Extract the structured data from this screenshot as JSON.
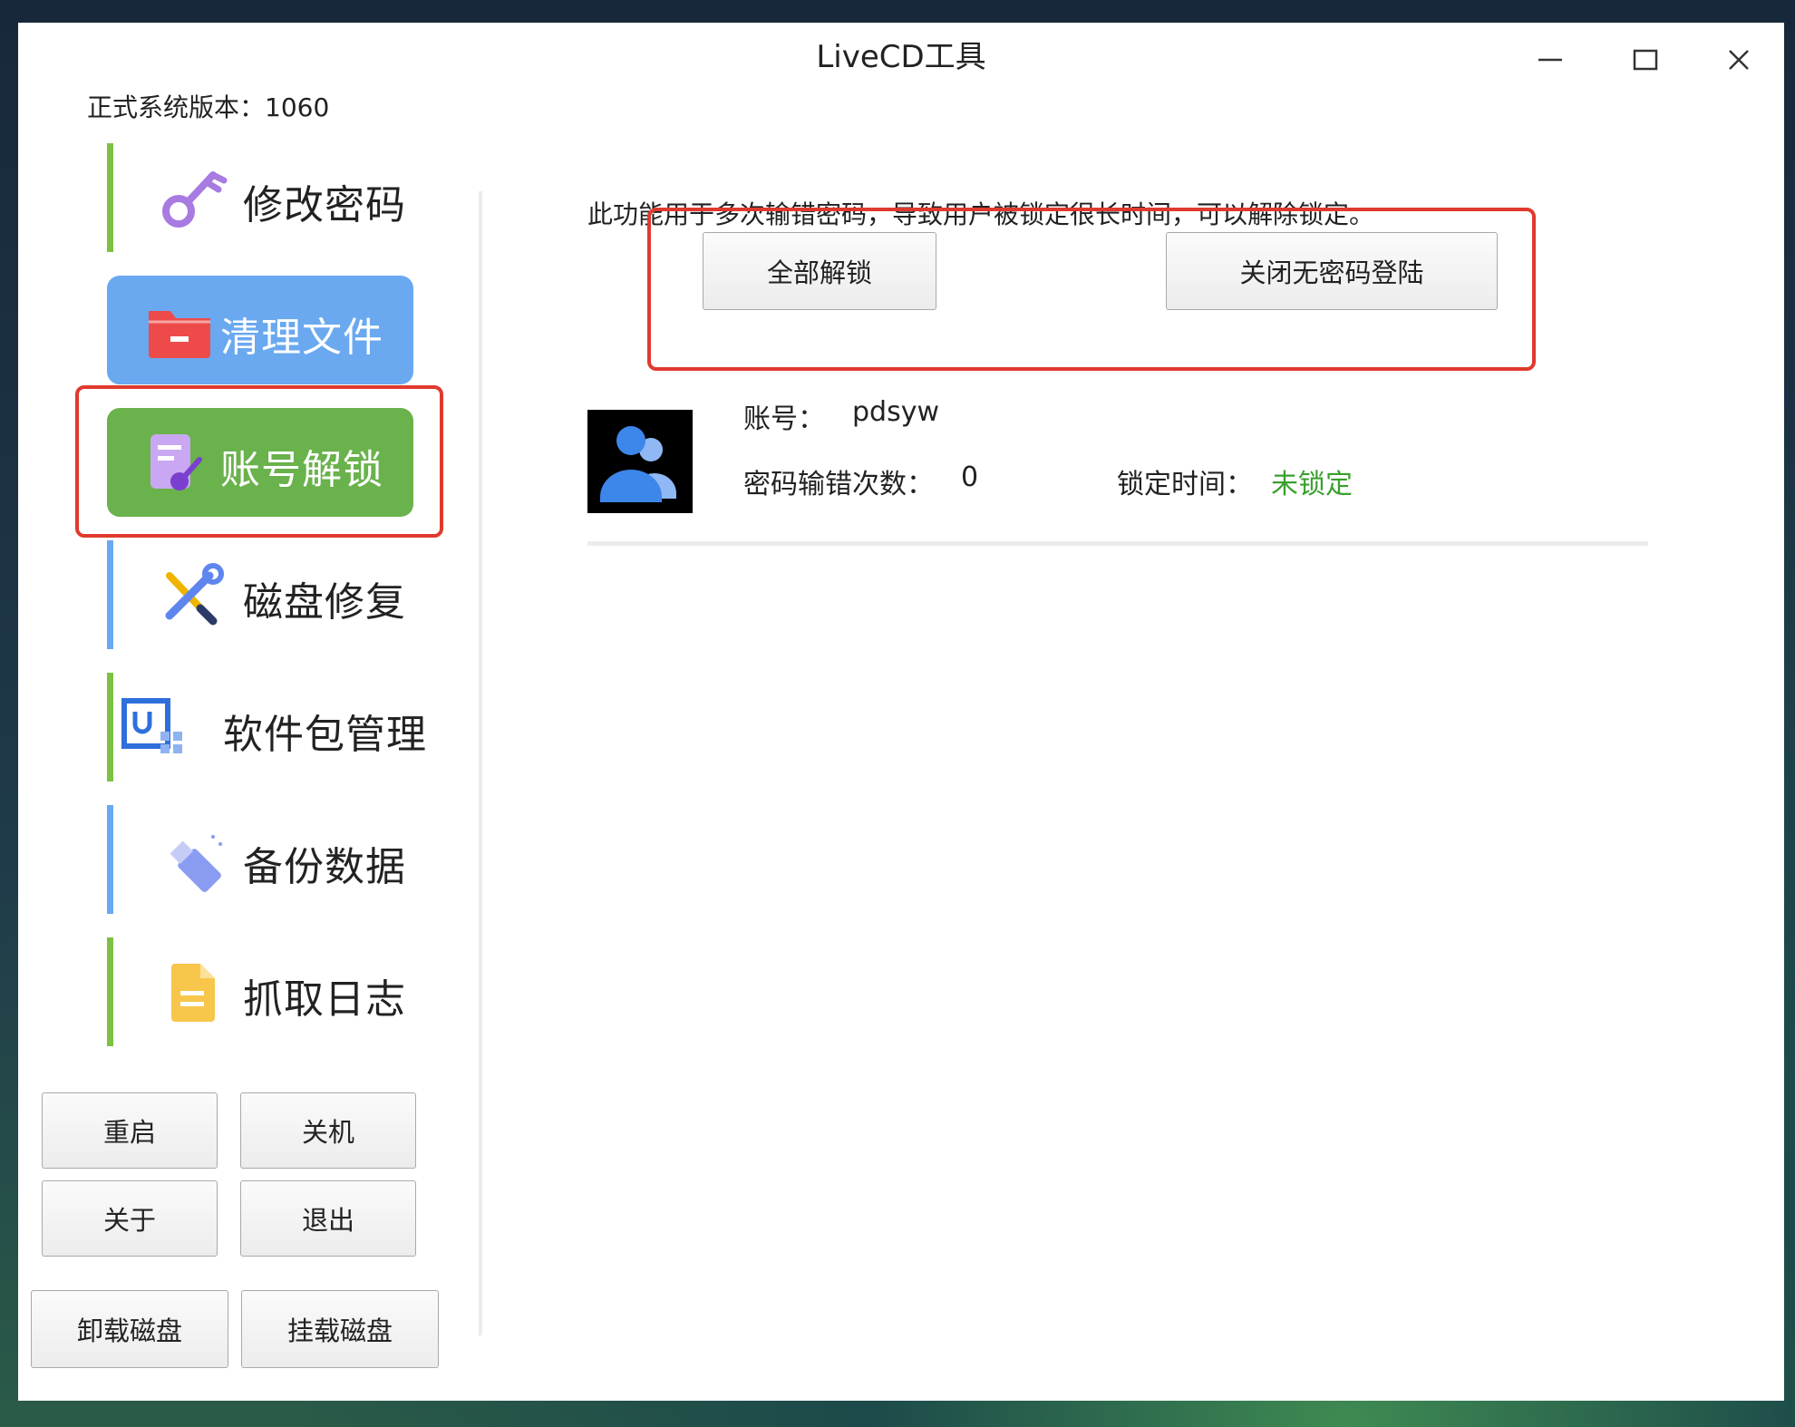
{
  "window": {
    "title": "LiveCD工具",
    "version_label": "正式系统版本：",
    "version_value": "1060"
  },
  "sidebar": {
    "items": [
      {
        "label": "修改密码",
        "icon": "key-icon",
        "bar_color": "#7cc142"
      },
      {
        "label": "清理文件",
        "icon": "folder-remove-icon",
        "bg_color": "#6aa8f0"
      },
      {
        "label": "账号解锁",
        "icon": "document-key-icon",
        "bg_color": "#6ab24c",
        "selected": true
      },
      {
        "label": "磁盘修复",
        "icon": "tools-icon",
        "bar_color": "#6aa8f0"
      },
      {
        "label": "软件包管理",
        "icon": "package-icon",
        "bar_color": "#7cc142"
      },
      {
        "label": "备份数据",
        "icon": "usb-drive-icon",
        "bar_color": "#6aa8f0"
      },
      {
        "label": "抓取日志",
        "icon": "log-file-icon",
        "bar_color": "#7cc142"
      }
    ],
    "buttons": {
      "reboot": "重启",
      "shutdown": "关机",
      "about": "关于",
      "exit": "退出",
      "unmount": "卸载磁盘",
      "mount": "挂载磁盘"
    }
  },
  "main": {
    "description": "此功能用于多次输错密码，导致用户被锁定很长时间，可以解除锁定。",
    "unlock_all": "全部解锁",
    "close_passwordless": "关闭无密码登陆",
    "account": {
      "account_label": "账号：",
      "account_value": "pdsyw",
      "errors_label": "密码输错次数：",
      "errors_value": "0",
      "lock_label": "锁定时间：",
      "lock_value": "未锁定",
      "lock_color": "#3aa02e"
    }
  },
  "colors": {
    "highlight": "#e03a2e",
    "accent_blue": "#6aa8f0",
    "accent_green": "#6ab24c"
  }
}
